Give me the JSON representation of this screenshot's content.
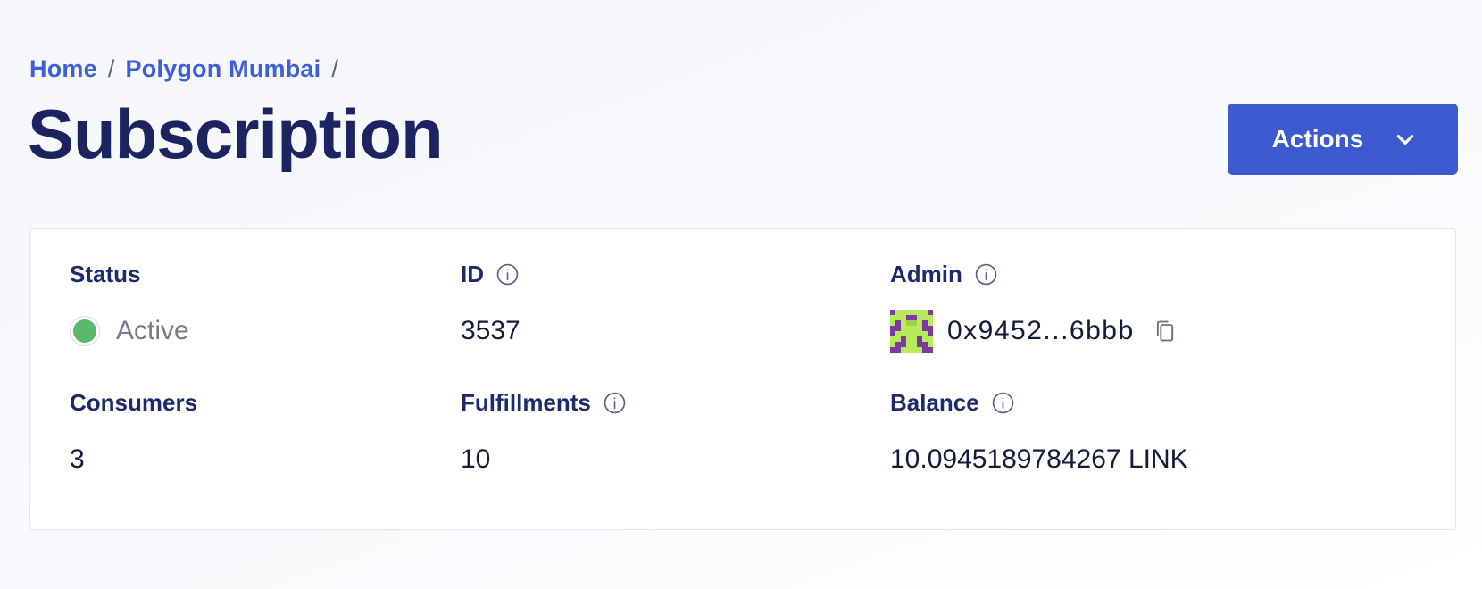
{
  "breadcrumb": {
    "items": [
      "Home",
      "Polygon Mumbai"
    ],
    "separator": "/"
  },
  "page": {
    "title": "Subscription"
  },
  "actions": {
    "label": "Actions",
    "icon": "chevron-down-icon"
  },
  "details": {
    "status": {
      "label": "Status",
      "value": "Active",
      "color": "#5bb86c"
    },
    "id": {
      "label": "ID",
      "value": "3537"
    },
    "admin": {
      "label": "Admin",
      "value": "0x9452...6bbb"
    },
    "consumers": {
      "label": "Consumers",
      "value": "3"
    },
    "fulfillments": {
      "label": "Fulfillments",
      "value": "10"
    },
    "balance": {
      "label": "Balance",
      "value": "10.0945189784267 LINK"
    }
  },
  "colors": {
    "accent": "#3c59cf",
    "link": "#3d5fd8",
    "heading": "#1b2461",
    "status_active": "#5bb86c"
  }
}
